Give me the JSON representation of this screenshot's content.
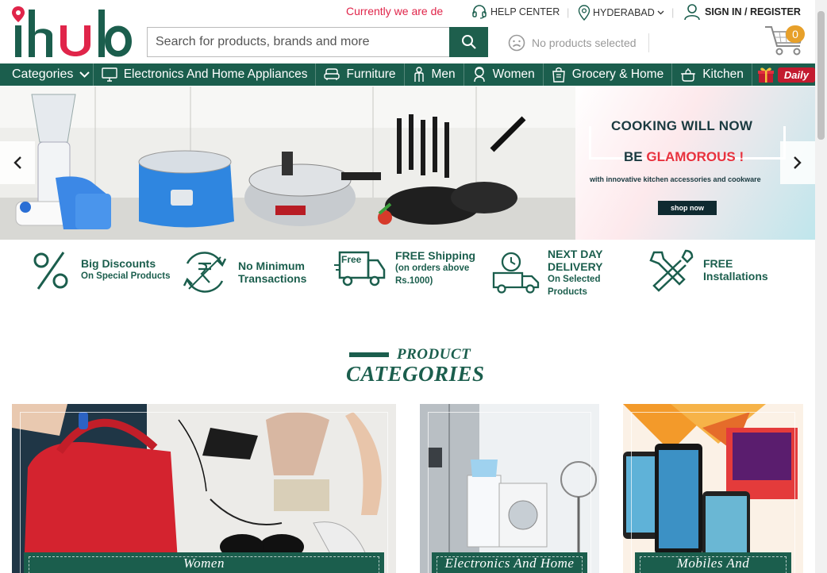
{
  "header": {
    "logo_text": "ihub",
    "notice": "Currently we are de",
    "help_center": "HELP CENTER",
    "city": "HYDERABAD",
    "signin": "SIGN IN / REGISTER",
    "search_placeholder": "Search for products, brands and more",
    "compare_text": "No products selected",
    "cart_count": "0"
  },
  "nav": {
    "categories_label": "Categories",
    "items": [
      {
        "label": "Electronics And Home Appliances",
        "icon": "monitor-icon"
      },
      {
        "label": "Furniture",
        "icon": "sofa-icon"
      },
      {
        "label": "Men",
        "icon": "man-icon"
      },
      {
        "label": "Women",
        "icon": "woman-icon"
      },
      {
        "label": "Grocery & Home",
        "icon": "grocery-bag-icon"
      },
      {
        "label": "Kitchen",
        "icon": "cooking-pot-icon"
      }
    ],
    "daily_label": "Daily"
  },
  "banner": {
    "line1": "COOKING WILL NOW",
    "line2_prefix": "BE ",
    "line2_highlight": "GLAMOROUS !",
    "subline": "with innovative kitchen accessories and cookware",
    "cta": "shop now"
  },
  "features": [
    {
      "title": "Big Discounts",
      "sub": "On Special Products",
      "icon": "percent-icon"
    },
    {
      "title": "No Minimum",
      "title2": "Transactions",
      "icon": "rupee-cycle-icon"
    },
    {
      "title": "FREE Shipping",
      "sub": "(on orders above",
      "sub2": "Rs.1000)",
      "icon": "free-truck-icon",
      "badge": "Free"
    },
    {
      "title": "NEXT DAY",
      "title2": "DELIVERY",
      "sub": "On Selected",
      "sub2": "Products",
      "icon": "clock-truck-icon"
    },
    {
      "title": "FREE",
      "title2": "Installations",
      "icon": "tools-icon"
    }
  ],
  "categories_heading": {
    "line1": "PRODUCT",
    "line2": "CATEGORIES"
  },
  "category_tiles": [
    {
      "label": "Women"
    },
    {
      "label": "Electronics And Home"
    },
    {
      "label": "Mobiles And"
    }
  ],
  "colors": {
    "brand_green": "#1b5e4d",
    "brand_red": "#e0254a",
    "cart_badge": "#e7a02a"
  }
}
